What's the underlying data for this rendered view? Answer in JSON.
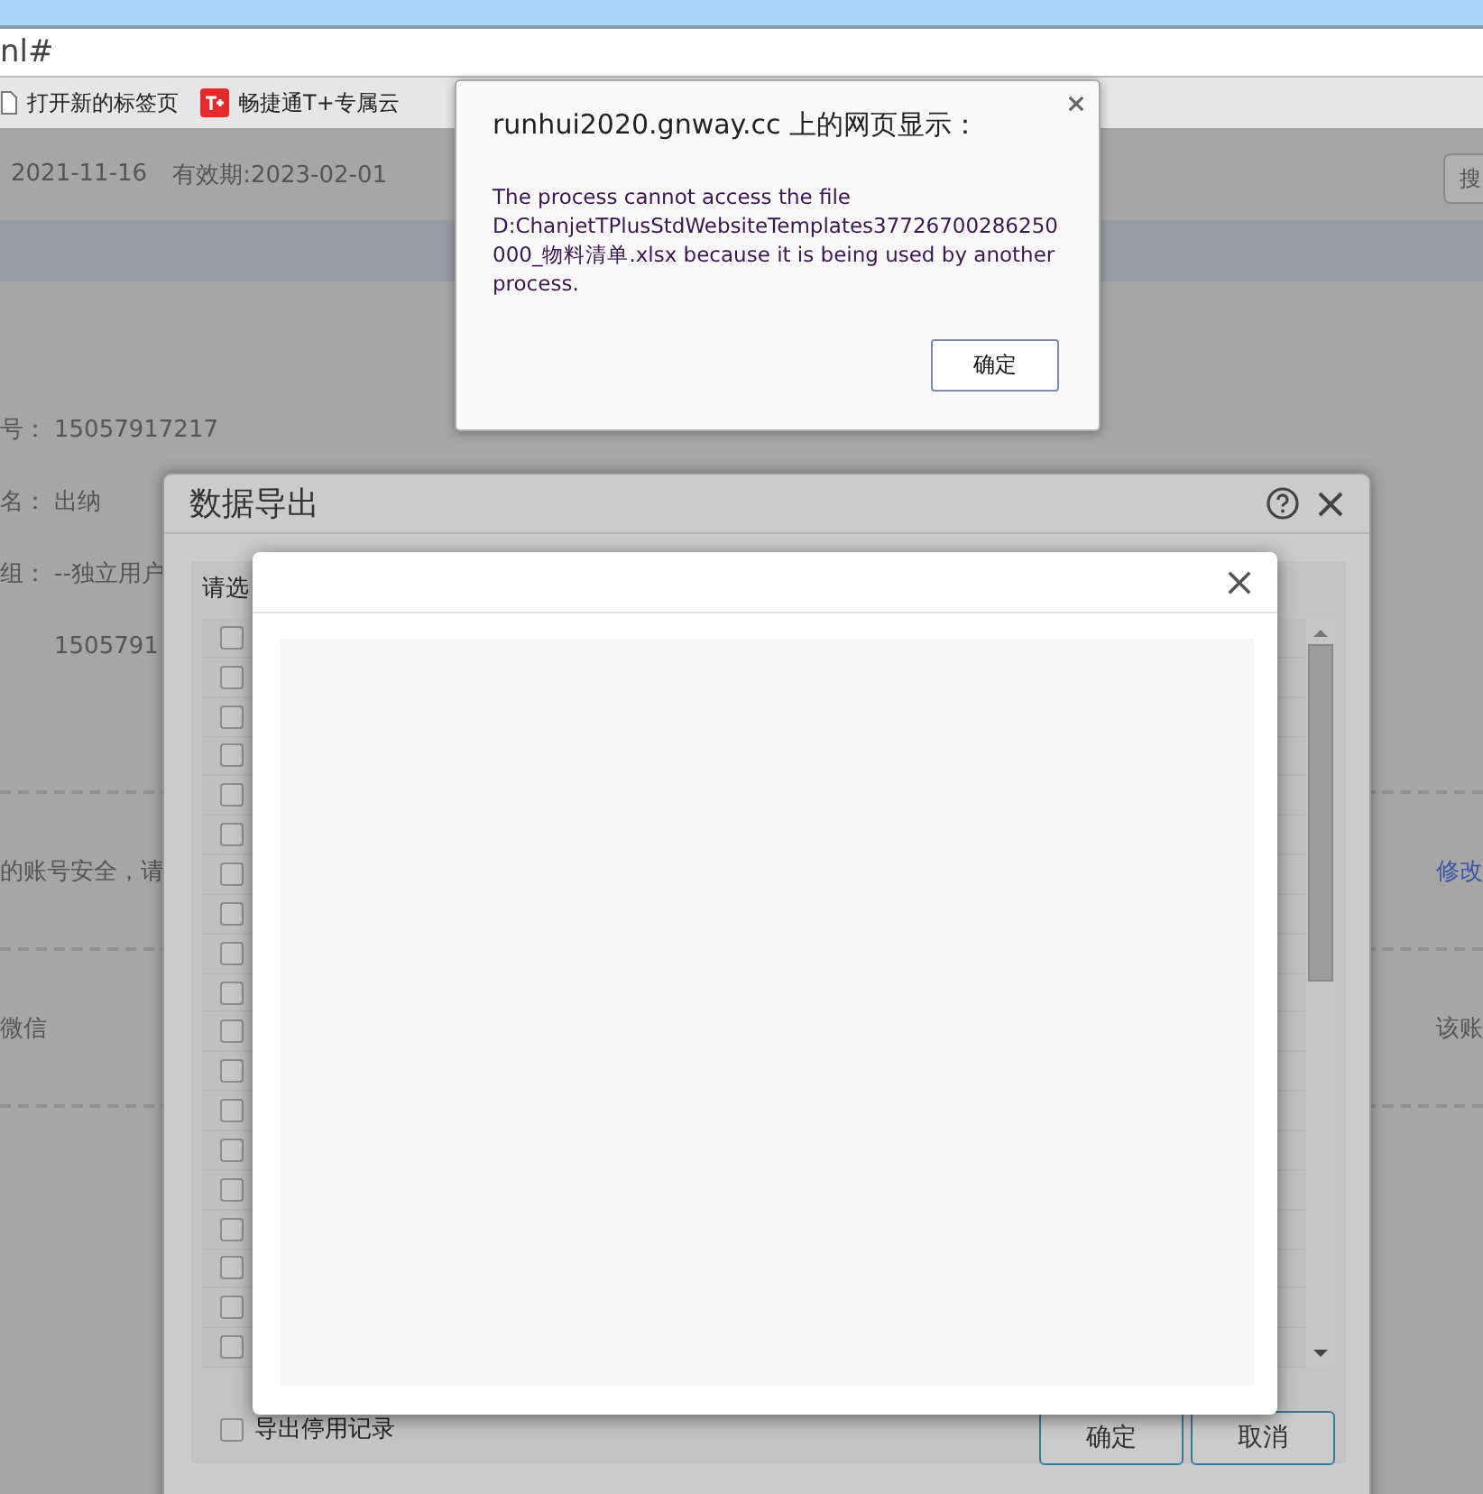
{
  "browser": {
    "address": "nl#",
    "bookmarks": [
      {
        "label": "打开新的标签页",
        "kind": "page"
      },
      {
        "label": "畅捷通T+专属云",
        "kind": "brand"
      }
    ]
  },
  "page": {
    "date": "2021-11-16",
    "expiry": "有效期:2023-02-01",
    "search_button": "搜",
    "fields": [
      {
        "label": "号：",
        "value": "15057917217"
      },
      {
        "label": "名：",
        "value": "出纳"
      },
      {
        "label": "组：",
        "value": "--独立用户"
      },
      {
        "value": "1505791"
      }
    ],
    "notices": [
      {
        "text": "的账号安全，请",
        "link": "修改"
      },
      {
        "text": "微信",
        "link": "该账",
        "kind": "plain"
      }
    ]
  },
  "export_dialog": {
    "title": "数据导出",
    "prompt": "请选",
    "rows": [
      {
        "checked": false
      },
      {
        "checked": false
      },
      {
        "checked": false
      },
      {
        "checked": false
      },
      {
        "checked": false
      },
      {
        "checked": false
      },
      {
        "checked": false
      },
      {
        "checked": false
      },
      {
        "checked": false
      },
      {
        "checked": false
      },
      {
        "checked": false
      },
      {
        "checked": false
      },
      {
        "checked": false
      },
      {
        "checked": false
      },
      {
        "checked": false
      },
      {
        "checked": false
      },
      {
        "checked": false
      },
      {
        "checked": false
      },
      {
        "checked": false
      }
    ],
    "option": {
      "label": "导出停用记录",
      "checked": false
    },
    "buttons": [
      "确定",
      "取消"
    ]
  },
  "alert": {
    "title": "runhui2020.gnway.cc 上的网页显示：",
    "message": "The process cannot access the file D:ChanjetTPlusStdWebsiteTemplates37726700286250000_物料清单.xlsx because it is being used by another process.",
    "button": "确定"
  }
}
